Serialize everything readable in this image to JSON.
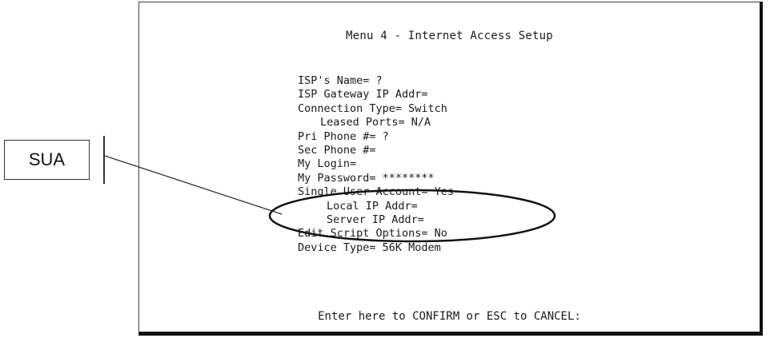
{
  "callout": {
    "label": "SUA"
  },
  "terminal": {
    "title": "Menu 4 - Internet Access Setup",
    "fields": [
      {
        "text": "ISP's Name= ?",
        "indent": 0
      },
      {
        "text": "ISP Gateway IP Addr=",
        "indent": 0
      },
      {
        "text": "Connection Type= Switch",
        "indent": 0
      },
      {
        "text": "Leased Ports= N/A",
        "indent": 1
      },
      {
        "text": "Pri Phone #= ?",
        "indent": 0
      },
      {
        "text": "Sec Phone #=",
        "indent": 0
      },
      {
        "text": "My Login=",
        "indent": 0
      },
      {
        "text": "My Password= ********",
        "indent": 0
      },
      {
        "text": "Single User Account= Yes",
        "indent": 0
      },
      {
        "text": "Local IP Addr=",
        "indent": 2
      },
      {
        "text": "Server IP Addr=",
        "indent": 2
      },
      {
        "text": "Edit Script Options= No",
        "indent": 0
      },
      {
        "text": "Device Type= 56K Modem",
        "indent": 0
      }
    ],
    "prompt": "Enter here to CONFIRM or ESC to CANCEL:"
  },
  "colors": {
    "ink": "#1a1a1a",
    "background": "#ffffff"
  }
}
